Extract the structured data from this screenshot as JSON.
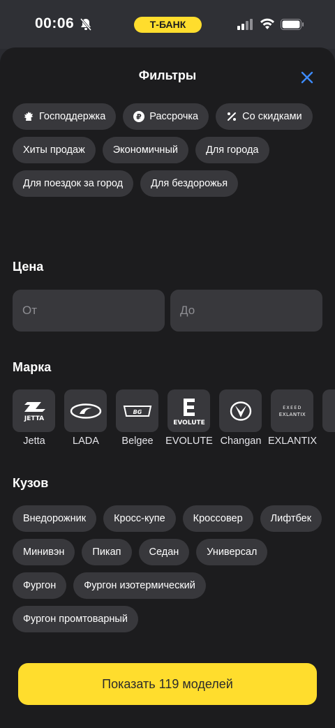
{
  "status_bar": {
    "time": "00:06",
    "bank_badge": "Т-БАНК"
  },
  "sheet": {
    "title": "Фильтры"
  },
  "tag_filters": [
    {
      "label": "Господдержка",
      "icon": "emblem-icon"
    },
    {
      "label": "Рассрочка",
      "icon": "ruble-icon"
    },
    {
      "label": "Со скидками",
      "icon": "percent-icon"
    },
    {
      "label": "Хиты продаж"
    },
    {
      "label": "Экономичный"
    },
    {
      "label": "Для города"
    },
    {
      "label": "Для поездок за город"
    },
    {
      "label": "Для бездорожья"
    }
  ],
  "price": {
    "title": "Цена",
    "from_placeholder": "От",
    "to_placeholder": "До"
  },
  "brand": {
    "title": "Марка",
    "items": [
      {
        "name": "Jetta",
        "logo_text": "JETTA"
      },
      {
        "name": "LADA"
      },
      {
        "name": "Belgee",
        "logo_text": "BG"
      },
      {
        "name": "EVOLUTE",
        "logo_text": "EVOLUTE"
      },
      {
        "name": "Changan"
      },
      {
        "name": "EXLANTIX",
        "logo_text": "EXEED"
      }
    ]
  },
  "body_type": {
    "title": "Кузов",
    "items": [
      "Внедорожник",
      "Кросс-купе",
      "Кроссовер",
      "Лифтбек",
      "Минивэн",
      "Пикап",
      "Седан",
      "Универсал",
      "Фургон",
      "Фургон изотермический",
      "Фургон промтоварный"
    ]
  },
  "submit": {
    "label": "Показать 119 моделей"
  },
  "colors": {
    "accent": "#ffdd2d",
    "close_icon": "#3d8bfd",
    "chip_bg": "#38383c",
    "sheet_bg": "#1c1c1e"
  }
}
